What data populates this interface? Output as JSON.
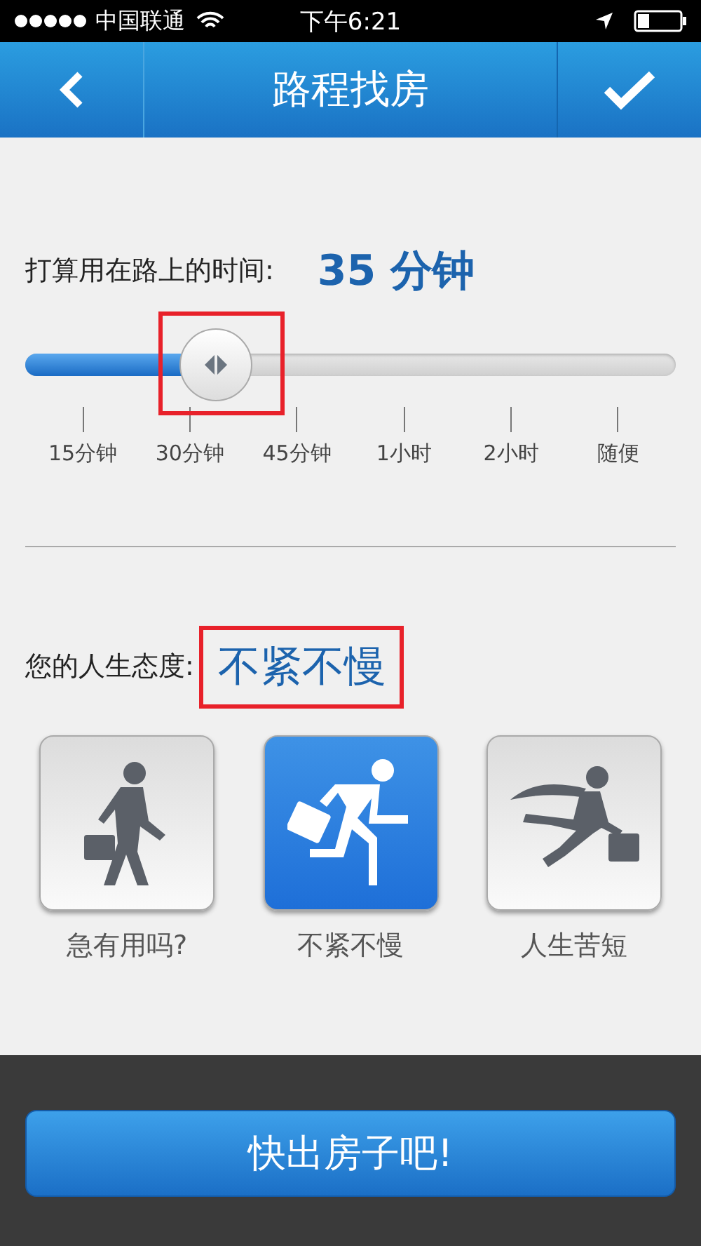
{
  "status_bar": {
    "carrier": "中国联通",
    "time": "下午6:21"
  },
  "nav_bar": {
    "title": "路程找房"
  },
  "commute": {
    "label": "打算用在路上的时间:",
    "value": "35 分钟",
    "level": 0.29,
    "highlighted": true,
    "ticks": [
      "15分钟",
      "30分钟",
      "45分钟",
      "1小时",
      "2小时",
      "随便"
    ]
  },
  "attitude": {
    "label": "您的人生态度:",
    "value": "不紧不慢",
    "highlighted": true,
    "options": [
      {
        "kind": "walk",
        "label": "急有用吗?",
        "selected": false
      },
      {
        "kind": "run",
        "label": "不紧不慢",
        "selected": true
      },
      {
        "kind": "dash",
        "label": "人生苦短",
        "selected": false
      }
    ]
  },
  "footer": {
    "button": "快出房子吧!"
  }
}
